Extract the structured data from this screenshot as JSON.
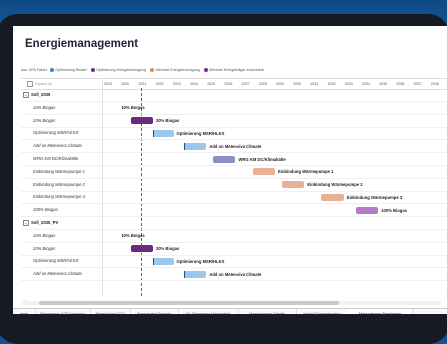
{
  "page": {
    "title": "Energiemanagement"
  },
  "legend": {
    "label": "Ass. KPA Faktor",
    "items": [
      {
        "label": "Optimierung Bedarf",
        "color": "#3e7fd0"
      },
      {
        "label": "Optimierung Energieerzeugung",
        "color": "#6a2a80"
      },
      {
        "label": "Wechsel Energieerzeugung",
        "color": "#e48a5c"
      },
      {
        "label": "Wechsel Energieträger erneuerbar",
        "color": "#7a2a90"
      }
    ]
  },
  "chart_data": {
    "type": "gantt",
    "expand_label": "Expand All",
    "years": [
      "2019",
      "2020",
      "2021",
      "2022",
      "2023",
      "2024",
      "2025",
      "2026",
      "2027",
      "2028",
      "2029",
      "2030",
      "2031",
      "2032",
      "2033",
      "2034",
      "2035",
      "2036",
      "2037",
      "2038"
    ],
    "today_year": 2021.2,
    "rows": [
      {
        "label": "Soll_2035",
        "group": true
      },
      {
        "label": "10% Biogas",
        "start": 2020,
        "end": 2020,
        "bar_label": "10% Biogas",
        "color": ""
      },
      {
        "label": "20% Biogas",
        "start": 2020.6,
        "end": 2021.9,
        "bar_label": "20% Biogas",
        "color": "#6a2a80"
      },
      {
        "label": "Optimierung MSR/HLKS",
        "start": 2021.9,
        "end": 2023.1,
        "bar_label": "Optimierung MSR/HLKS",
        "color": "#9cc7ec"
      },
      {
        "label": "Add on Meteoviva Climate",
        "start": 2023.7,
        "end": 2025.0,
        "bar_label": "Add on Meteoviva Climate",
        "color": "#9cc7ec"
      },
      {
        "label": "WRG KM DC/Klimakälte",
        "start": 2025.4,
        "end": 2026.7,
        "bar_label": "WRG KM DC/Klimakälte",
        "color": "#8a8fc8"
      },
      {
        "label": "Einbindung Wärmepumpe 1",
        "start": 2027.7,
        "end": 2029.0,
        "bar_label": "Einbindung Wärmepumpe 1",
        "color": "#eab095"
      },
      {
        "label": "Einbindung Wärmepumpe 2",
        "start": 2029.4,
        "end": 2030.7,
        "bar_label": "Einbindung Wärmepumpe 2",
        "color": "#eab095"
      },
      {
        "label": "Einbindung Wärmepumpe 3",
        "start": 2031.7,
        "end": 2033.0,
        "bar_label": "Einbindung Wärmepumpe 3",
        "color": "#eab095"
      },
      {
        "label": "100% Biogas",
        "start": 2033.7,
        "end": 2035.0,
        "bar_label": "100% Biogas",
        "color": "#b47cc4"
      },
      {
        "label": "Soll_2035_PV",
        "group": true
      },
      {
        "label": "10% Biogas",
        "start": 2020,
        "end": 2020,
        "bar_label": "10% Biogas",
        "color": ""
      },
      {
        "label": "20% Biogas",
        "start": 2020.6,
        "end": 2021.9,
        "bar_label": "20% Biogas",
        "color": "#6a2a80"
      },
      {
        "label": "Optimierung MSR/HLKS",
        "start": 2021.9,
        "end": 2023.1,
        "bar_label": "Optimierung MSR/HLKS",
        "color": "#9cc7ec"
      },
      {
        "label": "Add on Meteoviva Climate",
        "start": 2023.7,
        "end": 2025.0,
        "bar_label": "Add on Meteoviva Climate",
        "color": "#9cc7ec"
      }
    ]
  },
  "tabs": [
    {
      "label": "ierge"
    },
    {
      "label": "Benchmark CO2 Ausstoss"
    },
    {
      "label": "Absenkpfad CO2"
    },
    {
      "label": "Absenkpfad Energie"
    },
    {
      "label": "XY Diagramm Absenkpfad"
    },
    {
      "label": "Massnahmen Tabelle"
    },
    {
      "label": "Verlauf Energiekosten"
    },
    {
      "label": "Massnahmen Terminplan",
      "active": true
    }
  ]
}
